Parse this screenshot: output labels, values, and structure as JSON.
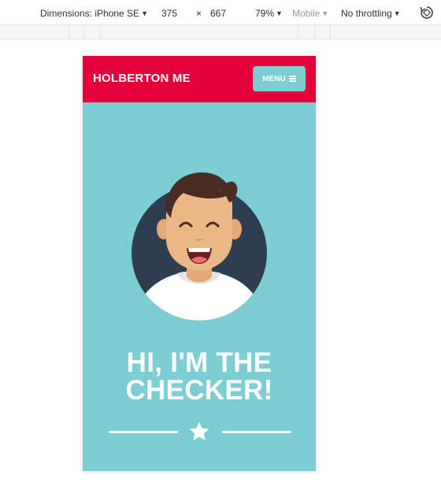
{
  "devtools": {
    "dimensions_label": "Dimensions: iPhone SE",
    "width": "375",
    "times": "×",
    "height": "667",
    "zoom": "79%",
    "device_type": "Mobile",
    "throttling": "No throttling"
  },
  "site": {
    "logo": "HOLBERTON ME",
    "menu_label": "MENU",
    "hero_line_1": "HI, I'M THE",
    "hero_line_2": "CHECKER!",
    "colors": {
      "header": "#e3003b",
      "body": "#7ccdd4",
      "avatar_bg": "#2e3e50",
      "text": "#ffffff"
    }
  }
}
